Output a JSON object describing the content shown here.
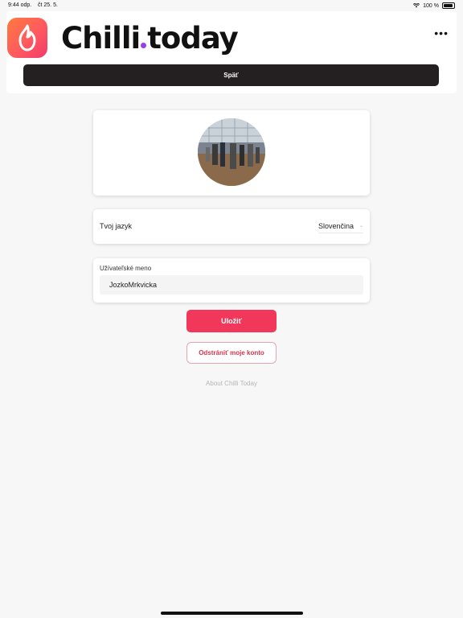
{
  "status_bar": {
    "time": "9:44 odp.",
    "date": "čt 25. 5.",
    "battery": "100 %"
  },
  "header": {
    "logo_part1": "Chilli",
    "logo_part2": "today",
    "menu_icon": "more-dots-icon",
    "back_label": "Späť"
  },
  "profile": {
    "language_label": "Tvoj jazyk",
    "language_value": "Slovenčina",
    "username_label": "Užívateľské meno",
    "username_value": "JozkoMrkvicka"
  },
  "actions": {
    "save_label": "Uložiť",
    "delete_label": "Odstrániť moje konto",
    "about_label": "About Chilli Today"
  },
  "colors": {
    "accent": "#f2385a",
    "header_button": "#242021",
    "logo_dot": "#9b3de8"
  }
}
